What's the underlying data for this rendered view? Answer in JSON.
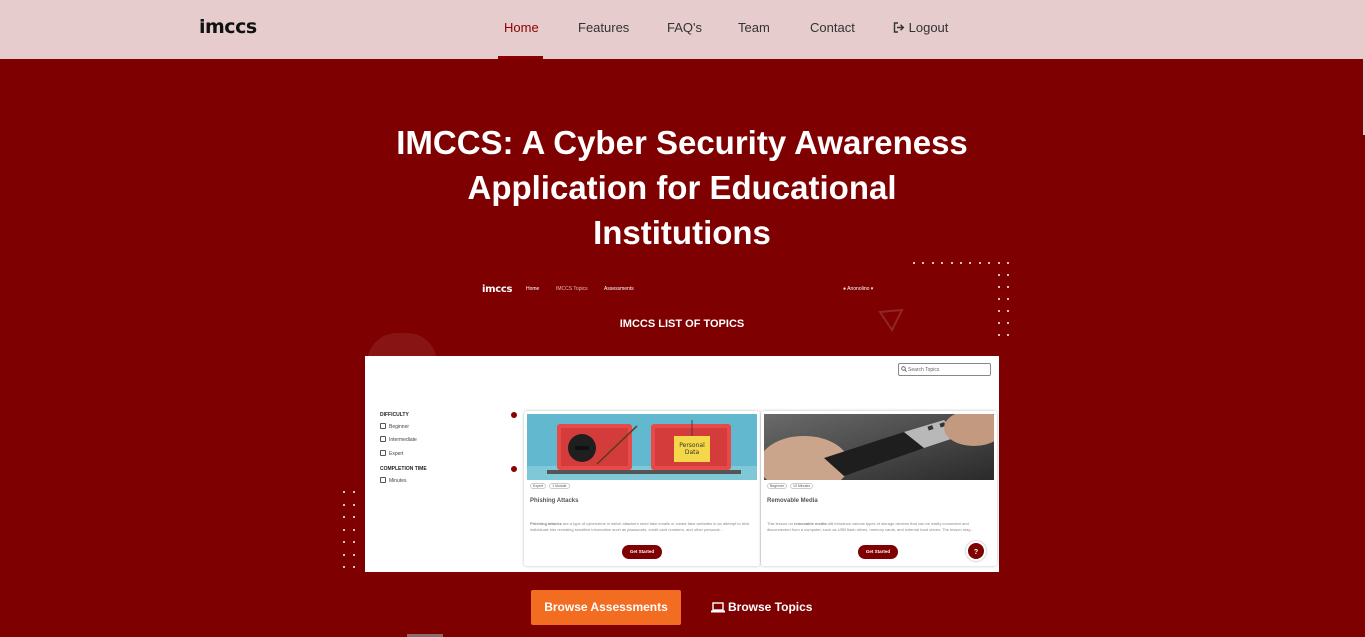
{
  "navbar": {
    "logo": "imccs",
    "items": [
      {
        "label": "Home",
        "active": true
      },
      {
        "label": "Features"
      },
      {
        "label": "FAQ's"
      },
      {
        "label": "Team"
      },
      {
        "label": "Contact"
      },
      {
        "label": "Logout",
        "icon": "sign-out-icon"
      }
    ]
  },
  "hero": {
    "title": "IMCCS: A Cyber Security Awareness Application for Educational Institutions"
  },
  "preview": {
    "logo": "imccs",
    "nav": [
      "Home",
      "IMCCS Topics",
      "Assessments"
    ],
    "user": "Anonolino",
    "heading": "IMCCS LIST OF TOPICS",
    "search_placeholder": "Search Topics",
    "filters": {
      "difficulty_label": "DIFFICULTY",
      "difficulty_options": [
        "Beginner",
        "Intermediate",
        "Expert"
      ],
      "time_label": "COMPLETION TIME",
      "time_options": [
        "Minutes"
      ]
    },
    "cards": [
      {
        "badges": [
          "Expert",
          "1 Module"
        ],
        "title": "Phishing Attacks",
        "image_text": "Personal Data",
        "text_bold": "Phishing attacks",
        "text": " are a type of cybercrime in which attackers send fake emails or create fake websites in an attempt to trick individuals into revealing sensitive information such as passwords, credit card numbers, and other personal...",
        "button": "Get Started"
      },
      {
        "badges": [
          "Beginner",
          "10 Minutes"
        ],
        "title": "Removable Media",
        "text_pre": "This lesson on ",
        "text_bold": "removable media",
        "text": " will introduce various types of storage devices that can be easily connected and disconnected from a computer, such as USB flash drives, memory cards, and external hard drives. The lesson may...",
        "button": "Get Started"
      }
    ],
    "help_label": "?"
  },
  "cta": {
    "assessments": "Browse Assessments",
    "topics": "Browse Topics"
  },
  "colors": {
    "brand": "#7e0000",
    "navbar_bg": "#e6cccc",
    "accent": "#f26c22"
  }
}
